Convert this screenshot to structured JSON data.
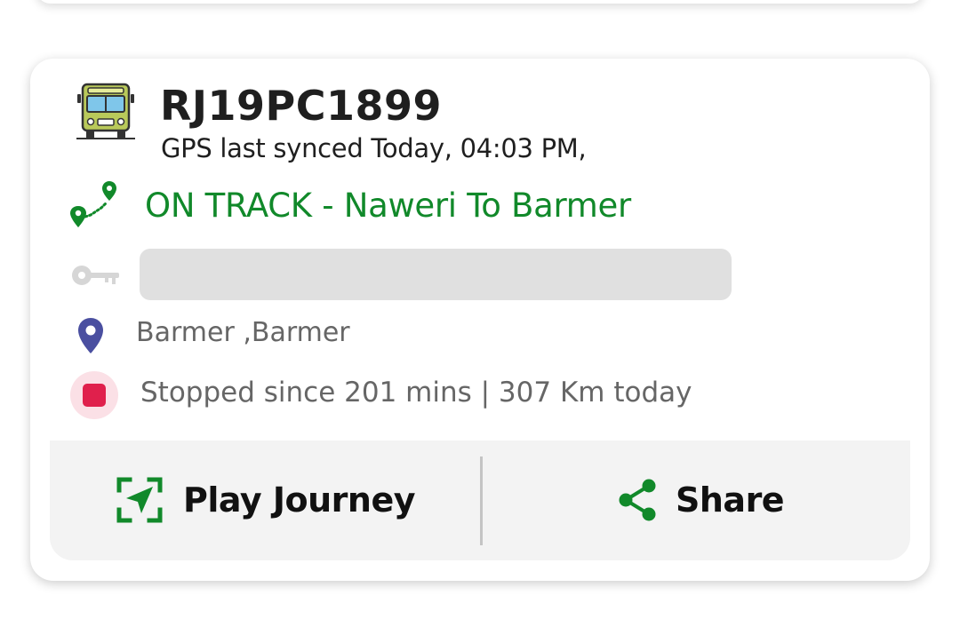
{
  "vehicle": {
    "number": "RJ19PC1899",
    "sync_text": "GPS last synced Today, 04:03 PM,",
    "icon": "bus-icon"
  },
  "route": {
    "status_line": "ON TRACK  -  Naweri To Barmer",
    "icon": "route-icon"
  },
  "key_field": {
    "icon": "key-icon",
    "value": ""
  },
  "location": {
    "text": "Barmer ,Barmer",
    "icon": "location-pin-icon"
  },
  "status": {
    "text": "Stopped since 201 mins |  307 Km today",
    "icon": "stop-icon"
  },
  "actions": {
    "play_journey_label": "Play Journey",
    "play_journey_icon": "navigation-arrow-icon",
    "share_label": "Share",
    "share_icon": "share-icon"
  },
  "colors": {
    "accent_green": "#11892a",
    "stop_red": "#e0204c",
    "pin_indigo": "#4a4fa0",
    "muted_text": "#666666"
  }
}
